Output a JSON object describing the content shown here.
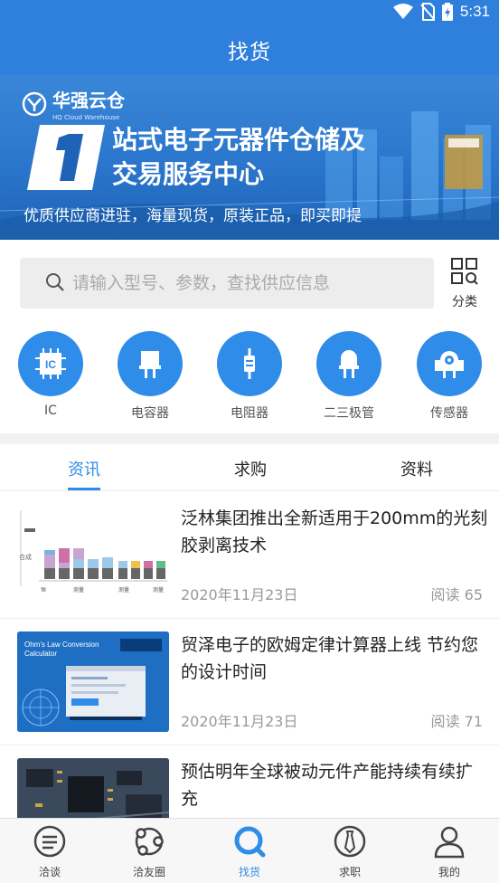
{
  "status_bar": {
    "time": "5:31",
    "icons": [
      "wifi-icon",
      "no-sim-icon",
      "battery-charging-icon"
    ]
  },
  "app_bar": {
    "title": "找货"
  },
  "banner": {
    "logo_text": "华强云仓",
    "logo_sub": "HQ Cloud Warehouse",
    "headline_line1": "站式电子元器件仓储及",
    "headline_line2": "交易服务中心",
    "subline": "优质供应商进驻，海量现货，原装正品，即买即提"
  },
  "search": {
    "placeholder": "请输入型号、参数，查找供应信息",
    "category_label": "分类"
  },
  "categories": [
    {
      "label": "IC",
      "icon": "ic-chip-icon"
    },
    {
      "label": "电容器",
      "icon": "capacitor-icon"
    },
    {
      "label": "电阻器",
      "icon": "resistor-icon"
    },
    {
      "label": "二三极管",
      "icon": "diode-icon"
    },
    {
      "label": "传感器",
      "icon": "sensor-icon"
    }
  ],
  "tabs": [
    {
      "label": "资讯",
      "active": true
    },
    {
      "label": "求购",
      "active": false
    },
    {
      "label": "资料",
      "active": false
    }
  ],
  "news": [
    {
      "title": "泛林集团推出全新适用于200mm的光刻胶剥离技术",
      "date": "2020年11月23日",
      "views": "阅读 65"
    },
    {
      "title": "贸泽电子的欧姆定律计算器上线 节约您的设计时间",
      "date": "2020年11月23日",
      "views": "阅读 71",
      "thumb_text": "Ohm's Law Conversion Calculator"
    },
    {
      "title": "预估明年全球被动元件产能持续有续扩充",
      "date": "",
      "views": ""
    }
  ],
  "bottom_nav": [
    {
      "label": "洽谈",
      "icon": "chat-icon",
      "active": false
    },
    {
      "label": "洽友圈",
      "icon": "circle-network-icon",
      "active": false
    },
    {
      "label": "找货",
      "icon": "search-icon",
      "active": true
    },
    {
      "label": "求职",
      "icon": "tie-icon",
      "active": false
    },
    {
      "label": "我的",
      "icon": "user-icon",
      "active": false
    }
  ],
  "colors": {
    "primary": "#2f7fdc",
    "accent": "#2f8ce8",
    "muted": "#999999"
  }
}
